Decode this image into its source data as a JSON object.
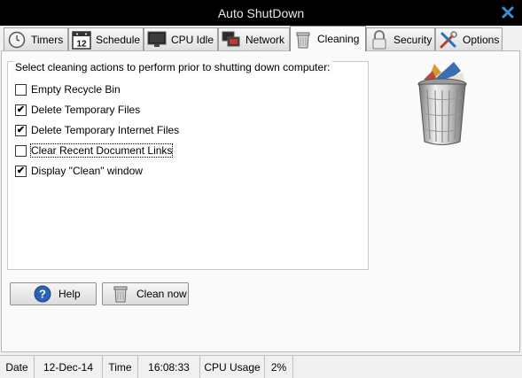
{
  "window": {
    "title": "Auto ShutDown",
    "close_icon": "close-x-icon",
    "close_color": "#3a8fd6"
  },
  "tabs": [
    {
      "label": "Timers",
      "icon": "clock-icon",
      "active": false
    },
    {
      "label": "Schedule",
      "icon": "calendar-icon",
      "calendar_day": "12",
      "active": false
    },
    {
      "label": "CPU Idle",
      "icon": "monitor-icon",
      "active": false
    },
    {
      "label": "Network",
      "icon": "network-icon",
      "active": false
    },
    {
      "label": "Cleaning",
      "icon": "trash-icon",
      "active": true
    },
    {
      "label": "Security",
      "icon": "padlock-icon",
      "active": false
    },
    {
      "label": "Options",
      "icon": "tools-icon",
      "active": false
    }
  ],
  "cleaning": {
    "group_label": "Select cleaning actions to perform prior to shutting down computer:",
    "options": [
      {
        "label": "Empty Recycle Bin",
        "checked": false
      },
      {
        "label": "Delete Temporary Files",
        "checked": true
      },
      {
        "label": "Delete Temporary Internet Files",
        "checked": true
      },
      {
        "label": "Clear Recent Document Links",
        "checked": false
      },
      {
        "label": "Display \"Clean\" window",
        "checked": true
      }
    ],
    "illustration": "full-trash-bin-icon"
  },
  "buttons": {
    "help_label": "Help",
    "help_icon": "question-icon",
    "clean_label": "Clean now",
    "clean_icon": "trash-icon"
  },
  "status": {
    "date_label": "Date",
    "date_value": "12-Dec-14",
    "time_label": "Time",
    "time_value": "16:08:33",
    "cpu_label": "CPU Usage",
    "cpu_value": "2%"
  }
}
